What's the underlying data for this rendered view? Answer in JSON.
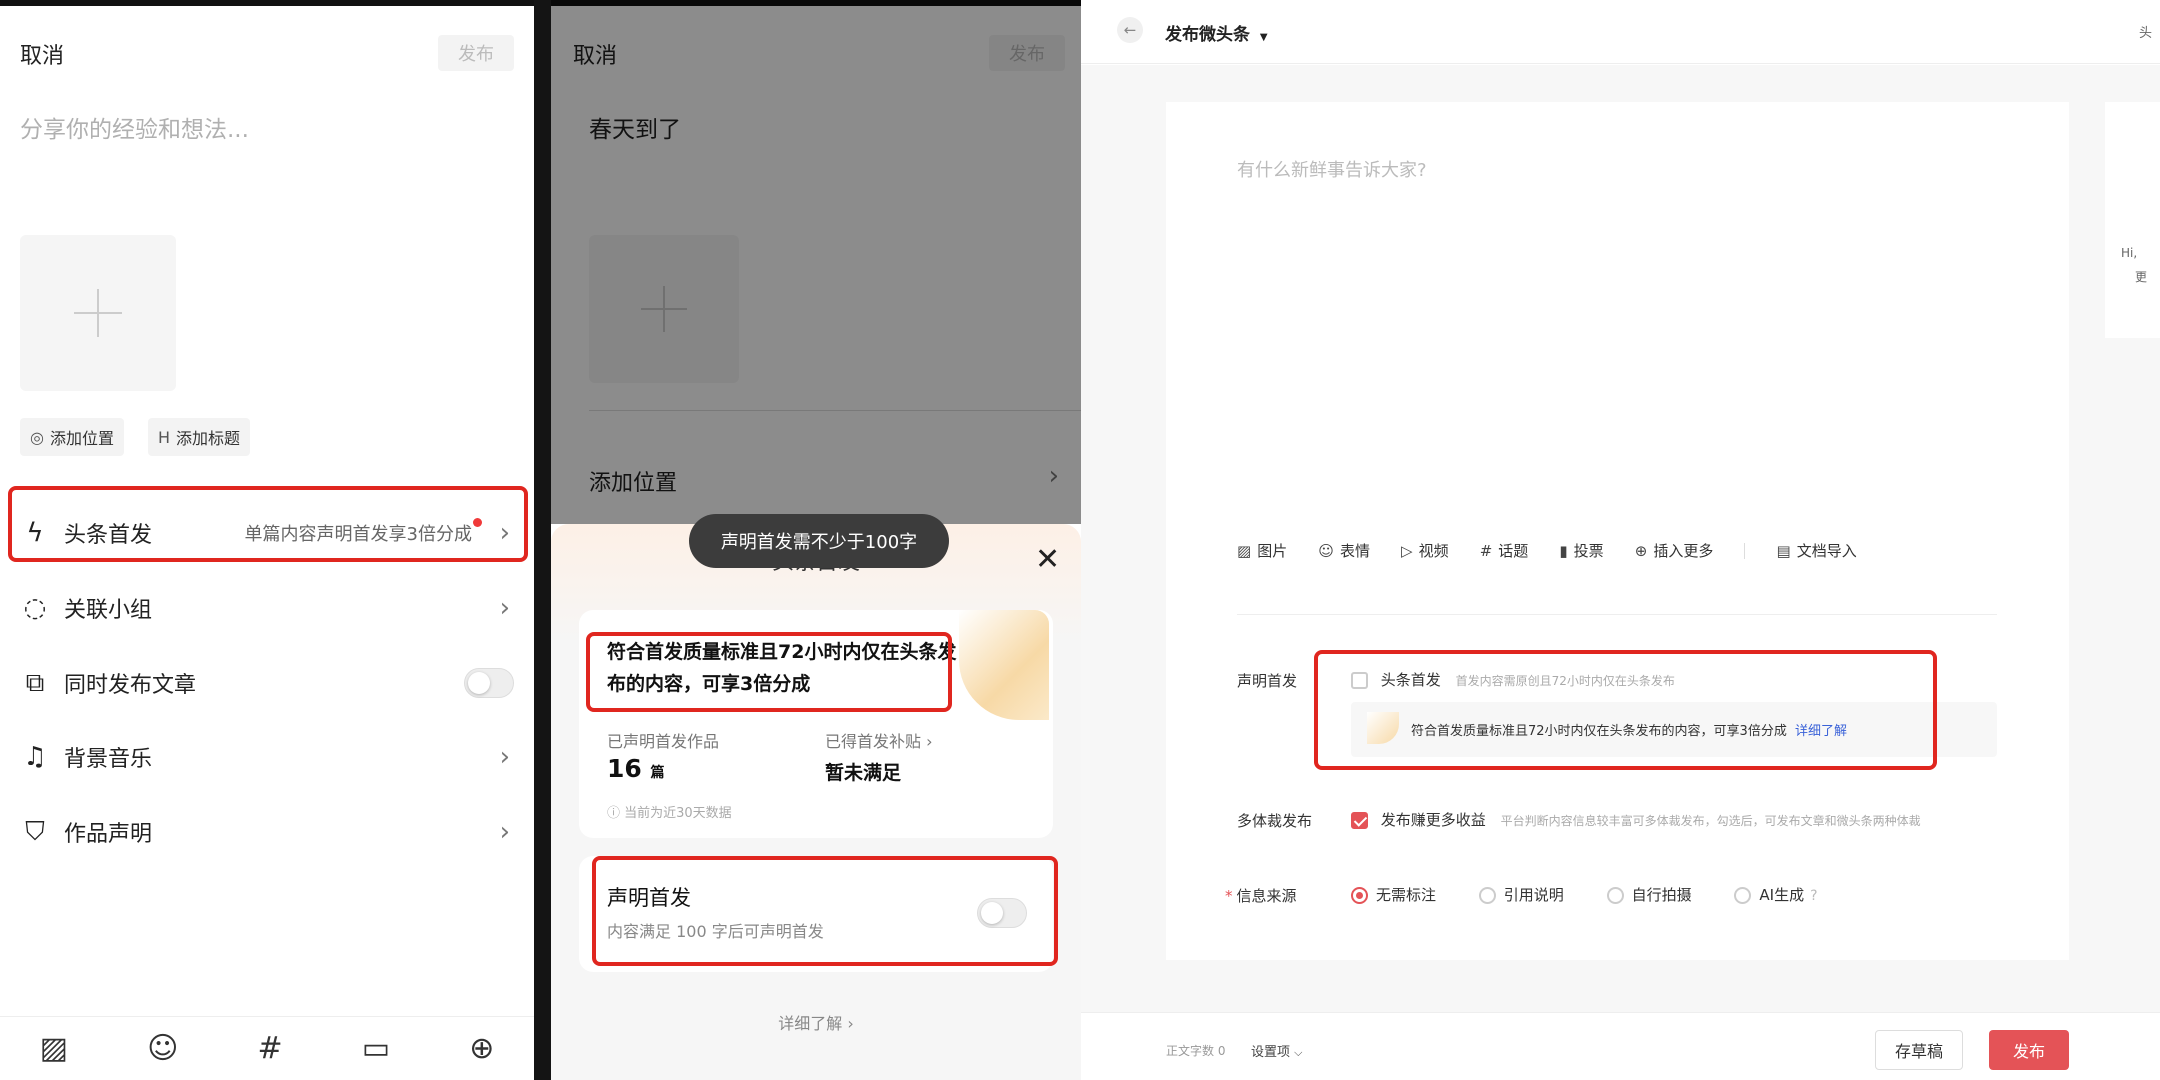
{
  "panel1": {
    "cancel": "取消",
    "publish": "发布",
    "placeholder": "分享你的经验和想法...",
    "chips": [
      "添加位置",
      "添加标题"
    ],
    "rows": [
      {
        "label": "头条首发",
        "desc": "单篇内容声明首发享3倍分成"
      },
      {
        "label": "关联小组"
      },
      {
        "label": "同时发布文章"
      },
      {
        "label": "背景音乐"
      },
      {
        "label": "作品声明"
      }
    ],
    "bottom_icons": [
      "image-icon",
      "emoji-icon",
      "hashtag-icon",
      "caption-icon",
      "plus-circle-icon"
    ]
  },
  "panel2": {
    "cancel": "取消",
    "publish": "发布",
    "content": "春天到了",
    "add_location": "添加位置",
    "toast": "声明首发需不少于100字",
    "sheet_title": "头条首发",
    "highlight": "符合首发质量标准且72小时内仅在头条发布的内容，可享3倍分成",
    "stat1_label": "已声明首发作品",
    "stat1_value": "16",
    "stat1_unit": "篇",
    "stat2_label": "已得首发补贴",
    "stat2_value": "暂未满足",
    "data_note": "当前为近30天数据",
    "declare_title": "声明首发",
    "declare_desc": "内容满足 100 字后可声明首发",
    "detail_link": "详细了解"
  },
  "panel3": {
    "title": "发布微头条",
    "top_right": "头",
    "side_card": [
      "Hi,",
      "更"
    ],
    "editor_placeholder": "有什么新鲜事告诉大家?",
    "toolbar": [
      "图片",
      "表情",
      "视频",
      "话题",
      "投票",
      "插入更多",
      "文档导入"
    ],
    "declare_label": "声明首发",
    "first_pub_label": "头条首发",
    "first_pub_hint": "首发内容需原创且72小时内仅在头条发布",
    "first_pub_info": "符合首发质量标准且72小时内仅在头条发布的内容，可享3倍分成",
    "first_pub_link": "详细了解",
    "multi_label": "多体裁发布",
    "multi_option": "发布赚更多收益",
    "multi_hint": "平台判断内容信息较丰富可多体裁发布，勾选后，可发布文章和微头条两种体裁",
    "source_label": "信息来源",
    "source_options": [
      "无需标注",
      "引用说明",
      "自行拍摄",
      "AI生成"
    ],
    "word_count": "正文字数 0",
    "settings": "设置项",
    "save_draft": "存草稿",
    "publish": "发布",
    "accent": "#e45357"
  }
}
